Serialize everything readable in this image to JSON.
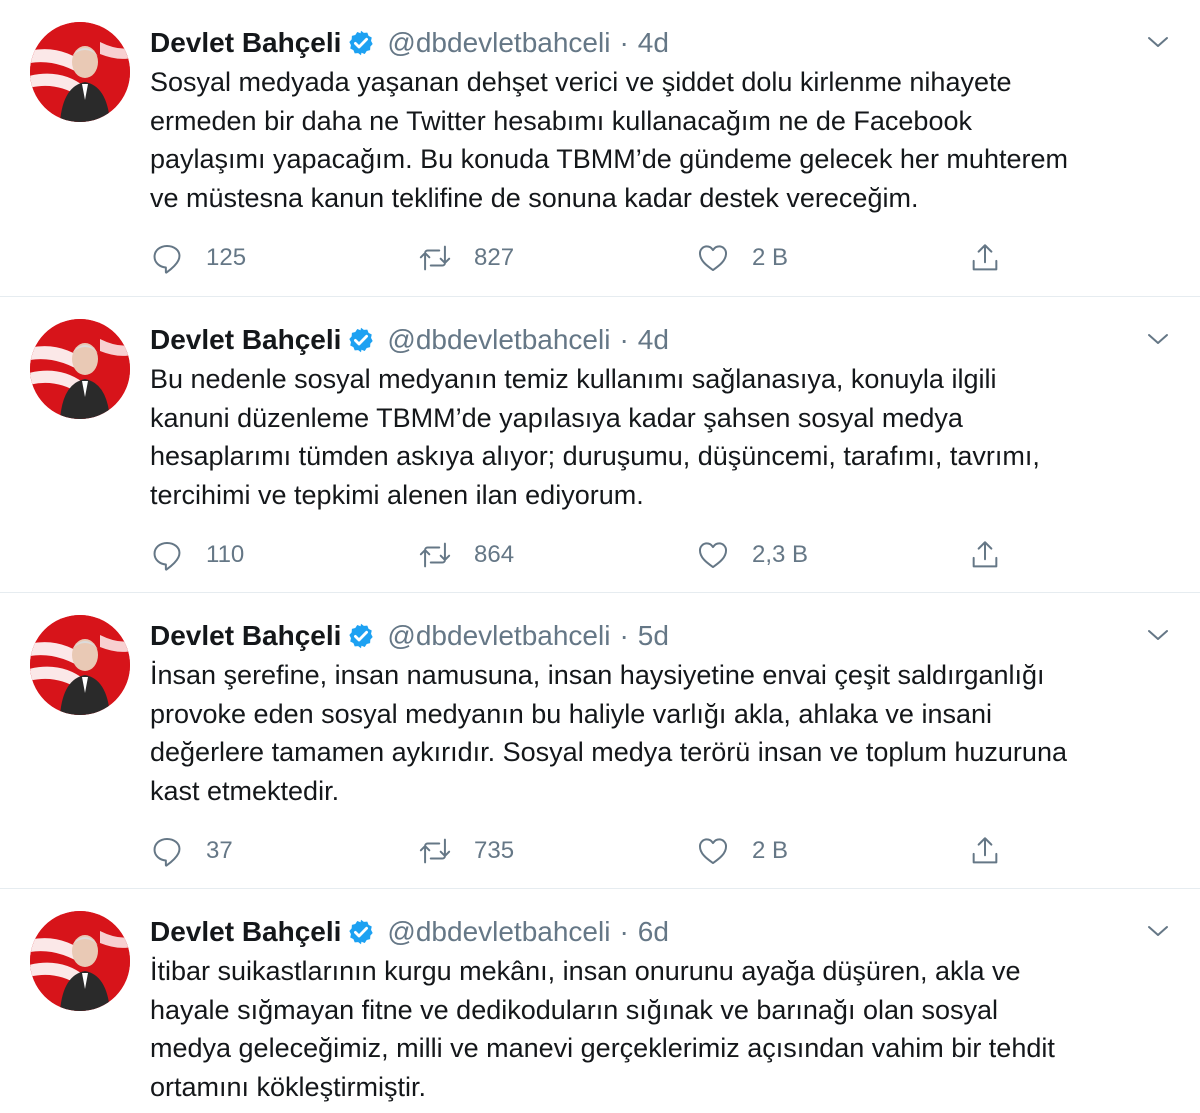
{
  "tweets": [
    {
      "author_name": "Devlet Bahçeli",
      "handle": "@dbdevletbahceli",
      "separator": "·",
      "time": "4d",
      "text_lines": [
        "Sosyal medyada yaşanan dehşet verici ve şiddet dolu kirlenme nihayete",
        "ermeden bir daha ne Twitter hesabımı kullanacağım ne de Facebook",
        "paylaşımı yapacağım. Bu konuda TBMM’de gündeme gelecek her muhterem",
        "ve müstesna kanun teklifine de sonuna kadar destek vereceğim."
      ],
      "replies": "125",
      "retweets": "827",
      "likes": "2 B"
    },
    {
      "author_name": "Devlet Bahçeli",
      "handle": "@dbdevletbahceli",
      "separator": "·",
      "time": "4d",
      "text_lines": [
        "Bu nedenle sosyal medyanın temiz kullanımı sağlanasıya, konuyla ilgili",
        "kanuni düzenleme TBMM’de yapılasıya kadar şahsen sosyal medya",
        "hesaplarımı tümden askıya alıyor; duruşumu, düşüncemi, tarafımı, tavrımı,",
        "tercihimi ve tepkimi alenen ilan ediyorum."
      ],
      "replies": "110",
      "retweets": "864",
      "likes": "2,3 B"
    },
    {
      "author_name": "Devlet Bahçeli",
      "handle": "@dbdevletbahceli",
      "separator": "·",
      "time": "5d",
      "text_lines": [
        "İnsan şerefine, insan namusuna, insan haysiyetine envai çeşit saldırganlığı",
        "provoke eden sosyal medyanın bu haliyle varlığı akla, ahlaka ve insani",
        "değerlere tamamen aykırıdır. Sosyal medya terörü insan ve toplum huzuruna",
        "kast etmektedir."
      ],
      "replies": "37",
      "retweets": "735",
      "likes": "2 B"
    },
    {
      "author_name": "Devlet Bahçeli",
      "handle": "@dbdevletbahceli",
      "separator": "·",
      "time": "6d",
      "text_lines": [
        "İtibar suikastlarının kurgu mekânı, insan onurunu ayağa düşüren, akla ve",
        "hayale sığmayan fitne ve dedikoduların sığınak ve barınağı olan sosyal",
        "medya geleceğimiz, milli ve manevi gerçeklerimiz açısından vahim bir tehdit",
        "ortamını kökleştirmiştir."
      ]
    }
  ],
  "colors": {
    "text": "#14171a",
    "muted": "#657786",
    "verified": "#1da1f2",
    "divider": "#e6ecf0",
    "avatar_red": "#d7141a"
  },
  "icons": {
    "verified": "verified-badge-icon",
    "caret": "chevron-down-icon",
    "reply": "reply-icon",
    "retweet": "retweet-icon",
    "like": "heart-icon",
    "share": "share-icon",
    "avatar": "profile-photo"
  }
}
